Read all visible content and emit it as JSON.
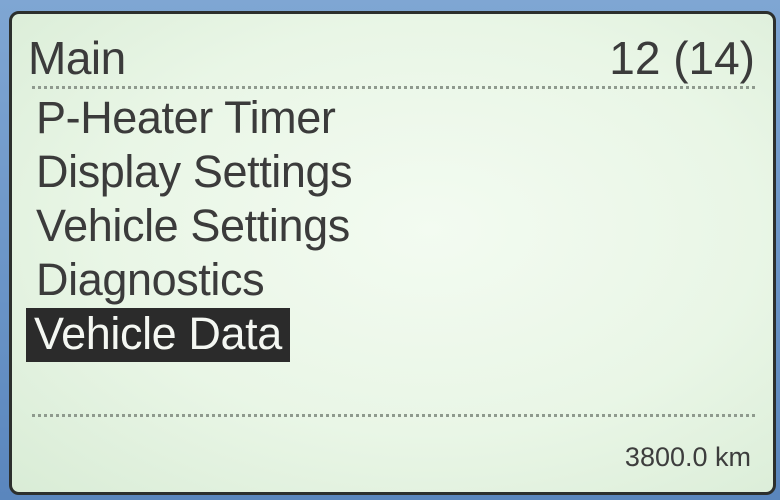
{
  "screen": {
    "title": "Main",
    "counter": "12 (14)",
    "odometer": "3800.0 km"
  },
  "menu": {
    "items": [
      {
        "label": "P-Heater Timer",
        "selected": false
      },
      {
        "label": "Display Settings",
        "selected": false
      },
      {
        "label": "Vehicle Settings",
        "selected": false
      },
      {
        "label": "Diagnostics",
        "selected": false
      },
      {
        "label": "Vehicle Data",
        "selected": true
      }
    ]
  },
  "colors": {
    "screen_background": "#e9f6e6",
    "text": "#3b3b3b",
    "selection_background": "#2b2b2b",
    "selection_text": "#f4f7f2",
    "frame": "#5b8fc7"
  }
}
